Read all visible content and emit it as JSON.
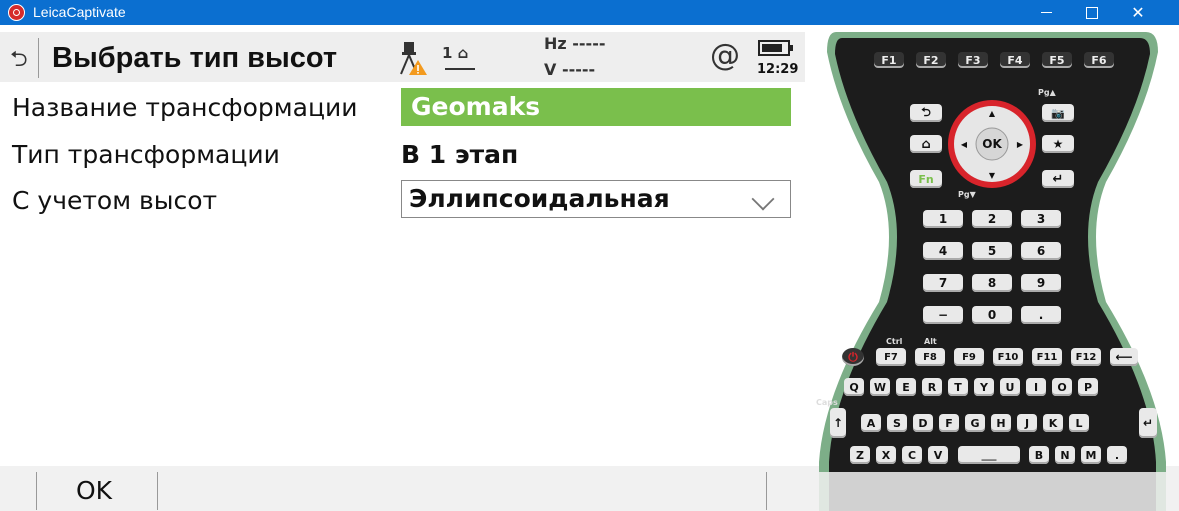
{
  "window": {
    "title": "LeicaCaptivate",
    "minimize": "–",
    "maximize": "□",
    "close": "✕"
  },
  "header": {
    "back_icon": "back-arrow-icon",
    "title": "Выбрать тип высот",
    "station_label": "1",
    "hz_label": "Hz -----",
    "v_label": "V  -----",
    "at_symbol": "@",
    "time": "12:29"
  },
  "form": {
    "transform_name": {
      "label": "Название трансформации",
      "value": "Geomaks"
    },
    "transform_type": {
      "label": "Тип трансформации",
      "value": "В 1 этап"
    },
    "heights": {
      "label": "С учетом высот",
      "value": "Эллипсоидальная"
    }
  },
  "footer": {
    "ok_label": "OK"
  },
  "keypad": {
    "fkeys": [
      "F1",
      "F2",
      "F3",
      "F4",
      "F5",
      "F6"
    ],
    "numkeys": [
      "1",
      "2",
      "3",
      "4",
      "5",
      "6",
      "7",
      "8",
      "9",
      "−",
      "0",
      "."
    ],
    "fn_label": "Fn",
    "ok_label": "OK",
    "fkeys2": [
      "F7",
      "F8",
      "F9",
      "F10",
      "F11",
      "F12"
    ],
    "row_q": [
      "Q",
      "W",
      "E",
      "R",
      "T",
      "Y",
      "U",
      "I",
      "O",
      "P"
    ],
    "row_a": [
      "A",
      "S",
      "D",
      "F",
      "G",
      "H",
      "J",
      "K",
      "L"
    ],
    "row_z": [
      "Z",
      "X",
      "C",
      "V",
      "B",
      "N",
      "M",
      "."
    ],
    "ctrl": "Ctrl",
    "alt": "Alt",
    "caps": "Caps",
    "pg_up": "Pg▲",
    "pg_down": "Pg▼"
  },
  "colors": {
    "accent_green": "#7abf4c",
    "titlebar_blue": "#0b6fd0",
    "keypad_green": "#7dae88",
    "keypad_dark": "#1c1c1c",
    "ring_red": "#d8242b"
  }
}
